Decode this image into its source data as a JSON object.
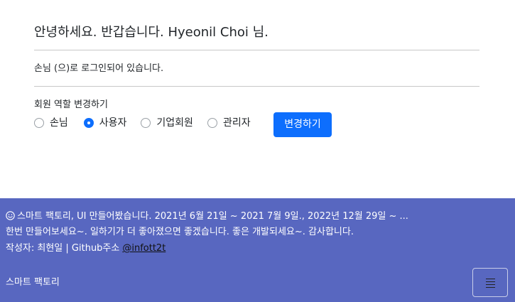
{
  "greeting": "안녕하세요. 반갑습니다. Hyeonil Choi 님.",
  "login_status": "손님 (으)로 로그인되어 있습니다.",
  "role_change": {
    "title": "회원 역할 변경하기",
    "options": [
      "손님",
      "사용자",
      "기업회원",
      "관리자"
    ],
    "selected": "사용자",
    "button_label": "변경하기"
  },
  "footer": {
    "line1": "스마트 팩토리, UI 만들어봤습니다. 2021년 6월 21일 ~ 2021 7월 9일., 2022년 12월 29일 ~ ...",
    "line2": "한번 만들어보세요~. 일하기가 더 좋아졌으면 좋겠습니다. 좋은 개발되세요~. 감사합니다.",
    "line3_prefix": "작성자: 최현일 | Github주소",
    "github_link_text": "@infott2t",
    "brand": "스마트 팩토리",
    "smile_icon": "smile-icon",
    "menu_icon": "hamburger-menu-icon"
  },
  "colors": {
    "primary": "#0d6efd",
    "footer_bg": "#5867c0"
  }
}
